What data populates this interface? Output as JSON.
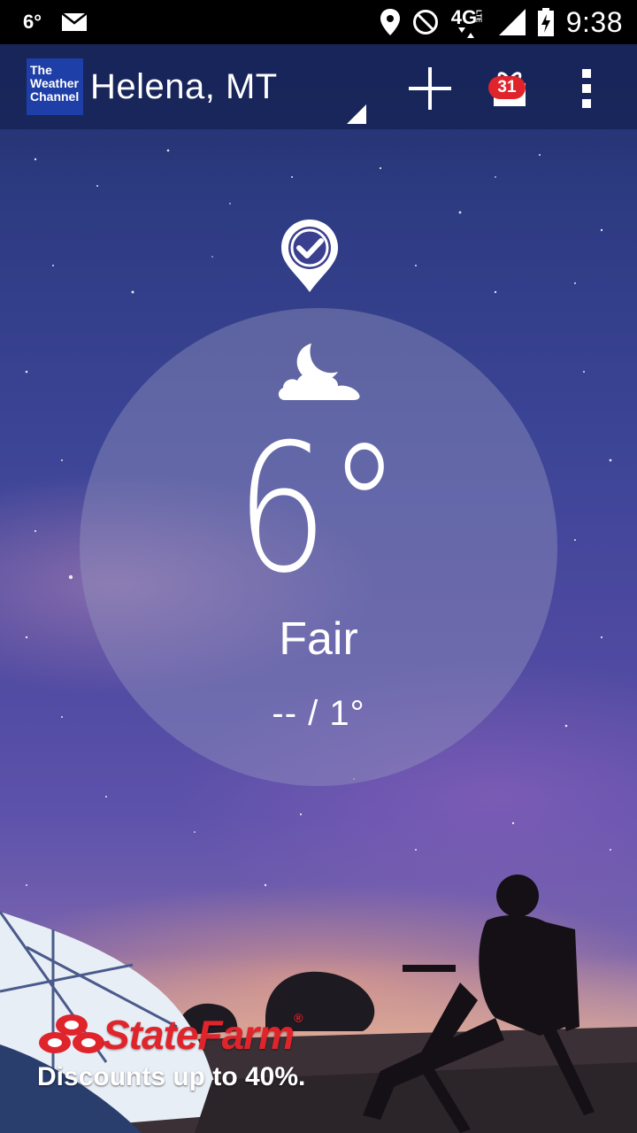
{
  "status_bar": {
    "temp": "6°",
    "network": "4G",
    "network_sub": "LTE",
    "time": "9:38",
    "icons": [
      "mail-icon",
      "location-icon",
      "do-not-disturb-icon",
      "signal-icon",
      "battery-charging-icon"
    ]
  },
  "app_bar": {
    "logo_lines": [
      "The",
      "Weather",
      "Channel"
    ],
    "location": "Helena, MT",
    "gift_badge": "31",
    "icons": [
      "add-icon",
      "gift-icon",
      "more-vert-icon"
    ]
  },
  "current": {
    "temperature": "6°",
    "phrase": "Fair",
    "hi_lo": "-- / 1°",
    "icon": "partly-cloudy-night-icon",
    "location_marker_icon": "check-pin-icon"
  },
  "ad": {
    "brand": "StateFarm",
    "trademark": "®",
    "text": "Discounts up to 40%.",
    "brand_color": "#e0242b"
  }
}
